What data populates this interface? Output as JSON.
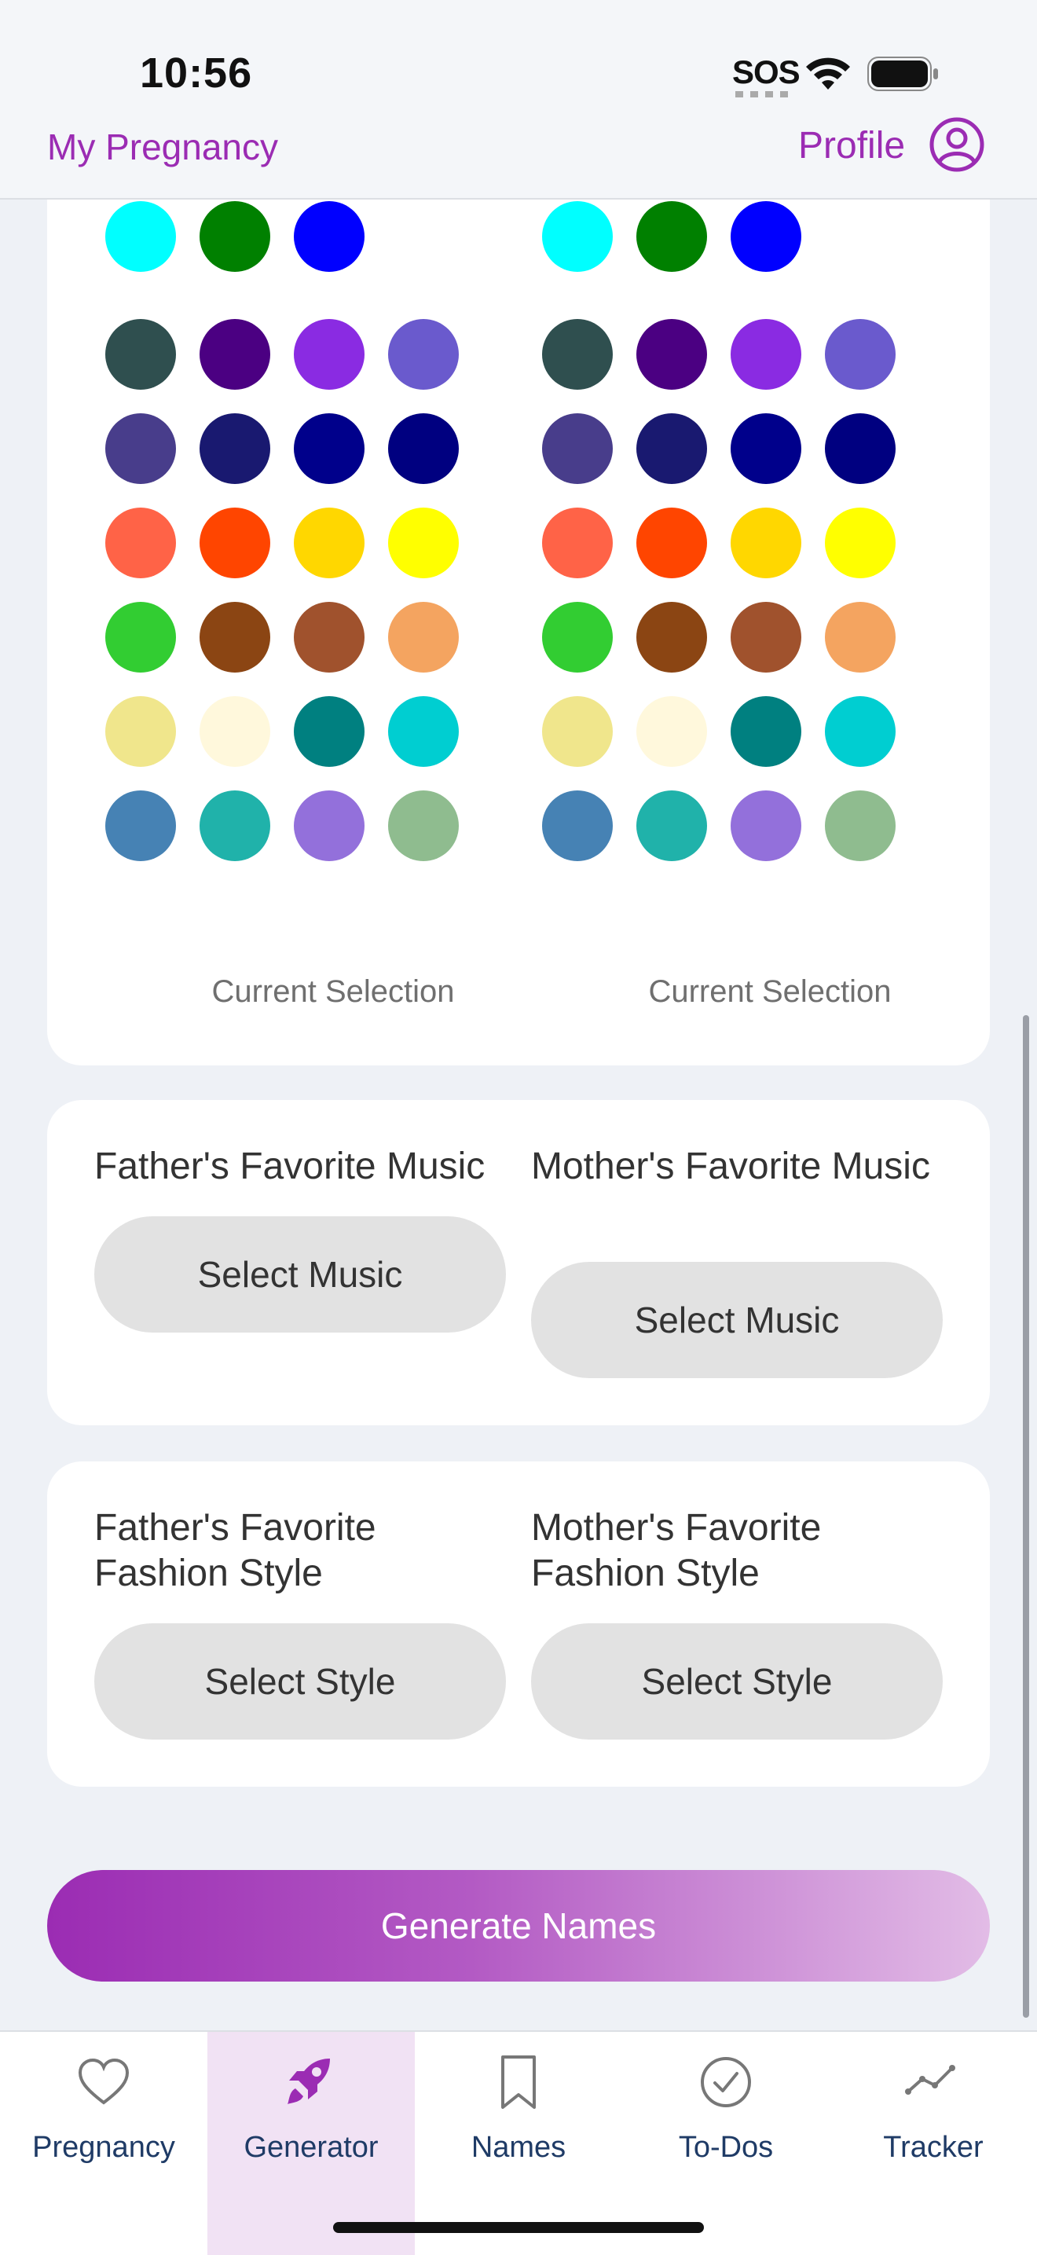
{
  "status_bar": {
    "time": "10:56",
    "sos": "SOS"
  },
  "nav": {
    "title": "My Pregnancy",
    "profile_label": "Profile"
  },
  "color_palette": {
    "columns": [
      {
        "rows": [
          [
            "#9c27b0",
            "#e1bee7",
            "#f48fb1",
            "#800080"
          ],
          [
            "#00ffff",
            "#008000",
            "#0000ff"
          ],
          [
            "#2f4f4f",
            "#4b0082",
            "#8a2be2",
            "#6a5acd"
          ],
          [
            "#483d8b",
            "#191970",
            "#00008b",
            "#000080"
          ],
          [
            "#ff6347",
            "#ff4500",
            "#ffd700",
            "#ffff00"
          ],
          [
            "#32cd32",
            "#8b4513",
            "#a0522d",
            "#f4a460"
          ],
          [
            "#f0e68c",
            "#fff8dc",
            "#008080",
            "#00ced1"
          ],
          [
            "#4682b4",
            "#20b2aa",
            "#9370db",
            "#8fbc8f"
          ]
        ],
        "current_selection_label": "Current Selection"
      },
      {
        "rows": [
          [
            "#9c27b0",
            "#e1bee7",
            "#f48fb1",
            "#800080"
          ],
          [
            "#00ffff",
            "#008000",
            "#0000ff"
          ],
          [
            "#2f4f4f",
            "#4b0082",
            "#8a2be2",
            "#6a5acd"
          ],
          [
            "#483d8b",
            "#191970",
            "#00008b",
            "#000080"
          ],
          [
            "#ff6347",
            "#ff4500",
            "#ffd700",
            "#ffff00"
          ],
          [
            "#32cd32",
            "#8b4513",
            "#a0522d",
            "#f4a460"
          ],
          [
            "#f0e68c",
            "#fff8dc",
            "#008080",
            "#00ced1"
          ],
          [
            "#4682b4",
            "#20b2aa",
            "#9370db",
            "#8fbc8f"
          ]
        ],
        "current_selection_label": "Current Selection"
      }
    ]
  },
  "music": {
    "father_label": "Father's Favorite Music",
    "mother_label": "Mother's Favorite Music",
    "father_button": "Select Music",
    "mother_button": "Select Music"
  },
  "fashion": {
    "father_label": "Father's Favorite Fashion Style",
    "mother_label": "Mother's Favorite Fashion Style",
    "father_button": "Select Style",
    "mother_button": "Select Style"
  },
  "generate_button": "Generate Names",
  "colors": {
    "accent": "#9b2cb3",
    "tab_label": "#1f3b66",
    "active_tab_bg": "#f1e2f4"
  },
  "tabs": [
    {
      "label": "Pregnancy",
      "icon": "heart-icon",
      "active": false
    },
    {
      "label": "Generator",
      "icon": "rocket-icon",
      "active": true
    },
    {
      "label": "Names",
      "icon": "bookmark-icon",
      "active": false
    },
    {
      "label": "To-Dos",
      "icon": "checkmark-circle-icon",
      "active": false
    },
    {
      "label": "Tracker",
      "icon": "chart-line-icon",
      "active": false
    }
  ]
}
